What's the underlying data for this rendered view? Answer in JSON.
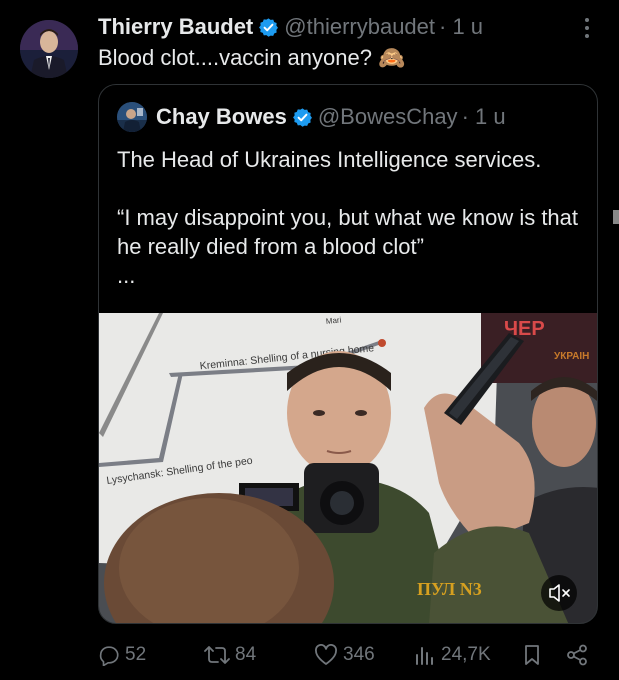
{
  "tweet": {
    "author": {
      "name": "Thierry Baudet",
      "handle": "@thierrybaudet",
      "time": "· 1 u"
    },
    "text": "Blood clot....vaccin anyone? 🙈"
  },
  "quote": {
    "author": {
      "name": "Chay Bowes",
      "handle": "@BowesChay",
      "time": "· 1 u"
    },
    "lines": [
      "The Head of Ukraines Intelligence services.",
      "“I may disappoint you, but what we know is that he really died from a blood clot”",
      "..."
    ],
    "media": {
      "map_label_1": "Kreminna: Shelling of a nursing home",
      "map_label_2": "Lysychansk: Shelling of the peo",
      "map_label_top": "Mari",
      "channel_logo": "ЧЕР",
      "channel_sub": "УКРАІН",
      "pool_text": "ПУЛ N3",
      "mute_icon": "speaker-muted-icon"
    }
  },
  "actions": {
    "replies": "52",
    "retweets": "84",
    "likes": "346",
    "views": "24,7K"
  },
  "colors": {
    "background": "#000000",
    "text": "#e7e9ea",
    "secondary": "#71767b",
    "verified": "#1d9bf0",
    "border": "#2f3336"
  }
}
